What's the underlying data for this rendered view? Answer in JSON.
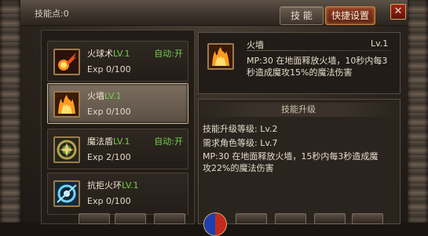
{
  "header": {
    "skill_points": "技能点:0",
    "tabs": [
      "技 能",
      "快捷设置"
    ],
    "close_symbol": "✕"
  },
  "skills": [
    {
      "name": "火球术",
      "level": "LV.1",
      "auto": "自动:开",
      "exp": "Exp 0/100",
      "icon": "fireball-icon",
      "selected": false
    },
    {
      "name": "火墙",
      "level": "LV.1",
      "auto": "",
      "exp": "Exp 0/100",
      "icon": "firewall-icon",
      "selected": true
    },
    {
      "name": "魔法盾",
      "level": "LV.1",
      "auto": "自动:开",
      "exp": "Exp 2/100",
      "icon": "magic-shield-icon",
      "selected": false
    },
    {
      "name": "抗拒火环",
      "level": "LV.1",
      "auto": "",
      "exp": "Exp 0/100",
      "icon": "repel-ring-icon",
      "selected": false
    }
  ],
  "detail": {
    "name": "火墙",
    "level": "Lv.1",
    "desc": "MP:30  在地面释放火墙，10秒内每3秒造成魔攻15%的魔法伤害"
  },
  "upgrade": {
    "title": "技能升级",
    "skill_level": "技能升级等级: Lv.2",
    "req_level": "需求角色等级: Lv.7",
    "desc": "MP:30  在地面释放火墙，15秒内每3秒造成魔攻22%的魔法伤害"
  },
  "colors": {
    "accent_green": "#72d04a",
    "tab_active": "#8c3b24"
  }
}
